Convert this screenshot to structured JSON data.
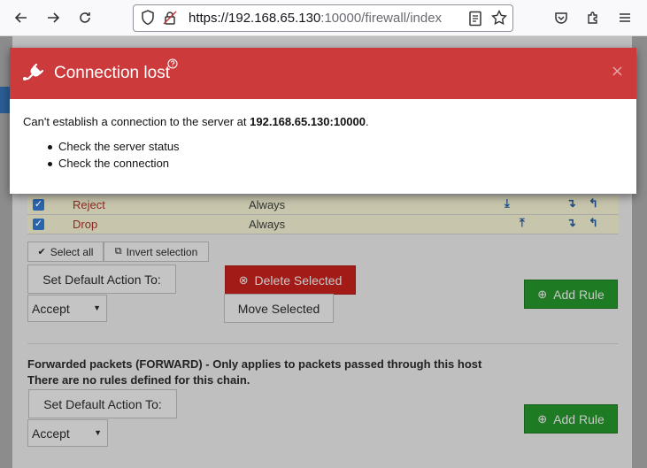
{
  "browser": {
    "url_host": "https://192.168.65.130",
    "url_rest": ":10000/firewall/index"
  },
  "rules": [
    {
      "action": "Reject",
      "condition": "Always",
      "checked": true
    },
    {
      "action": "Drop",
      "condition": "Always",
      "checked": true
    }
  ],
  "input_chain": {
    "select_all": "Select all",
    "invert_selection": "Invert selection",
    "set_default": "Set Default Action To:",
    "default_value": "Accept",
    "delete_selected": "Delete Selected",
    "move_selected": "Move Selected",
    "add_rule": "Add Rule"
  },
  "forward_chain": {
    "heading": "Forwarded packets (FORWARD) - Only applies to packets passed through this host",
    "empty_text": "There are no rules defined for this chain.",
    "set_default": "Set Default Action To:",
    "default_value": "Accept",
    "add_rule": "Add Rule"
  },
  "modal": {
    "title": "Connection lost",
    "message_prefix": "Can't establish a connection to the server at ",
    "server": "192.168.65.130:10000",
    "message_suffix": ".",
    "items": [
      "Check the server status",
      "Check the connection"
    ],
    "close": "×"
  },
  "colors": {
    "modal_header": "#cc3a3c",
    "danger": "#a21b17",
    "success": "#1f7a24",
    "checkbox": "#2a64ad"
  }
}
